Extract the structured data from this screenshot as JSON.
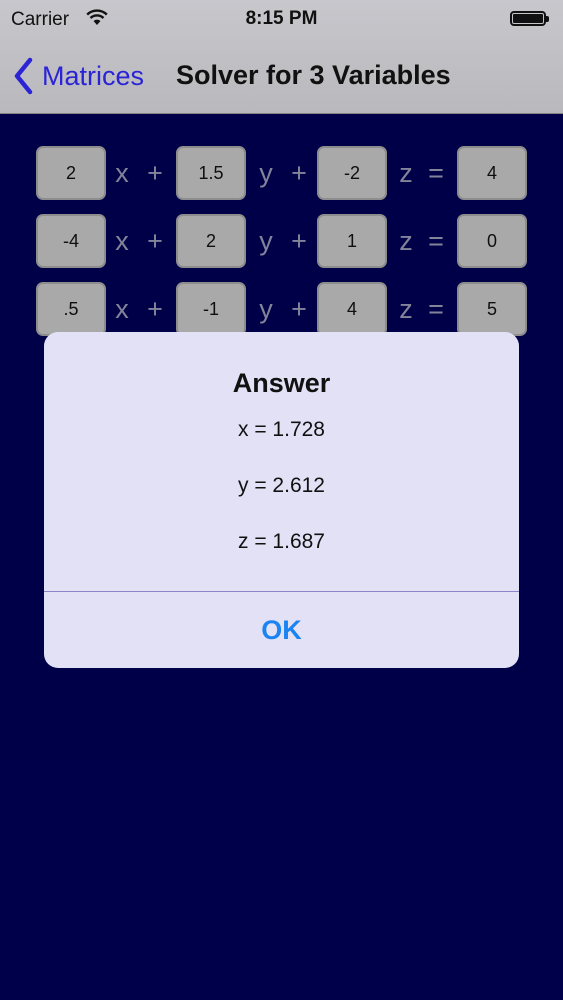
{
  "status_bar": {
    "carrier": "Carrier",
    "time": "8:15 PM",
    "wifi_icon": "wifi-icon",
    "battery_icon": "battery-icon"
  },
  "nav": {
    "back_label": "Matrices",
    "back_icon": "chevron-left-icon",
    "title": "Solver for 3 Variables",
    "accent_color": "#2b23d6"
  },
  "equations": [
    {
      "a": "2",
      "b": "1.5",
      "c": "-2",
      "d": "4"
    },
    {
      "a": "-4",
      "b": "2",
      "c": "1",
      "d": "0"
    },
    {
      "a": ".5",
      "b": "-1",
      "c": "4",
      "d": "5"
    }
  ],
  "operators": {
    "x": "x",
    "y": "y",
    "z": "z",
    "plus": "+",
    "equals": "="
  },
  "alert": {
    "title": "Answer",
    "x_result": "x = 1.728",
    "y_result": "y = 2.612",
    "z_result": "z = 1.687",
    "ok_label": "OK",
    "button_color": "#1b84f2"
  },
  "colors": {
    "background": "#000050",
    "nav_bar": "#c7c7cc",
    "cell": "#b8b8b8",
    "alert_bg": "#e3e1f6"
  }
}
